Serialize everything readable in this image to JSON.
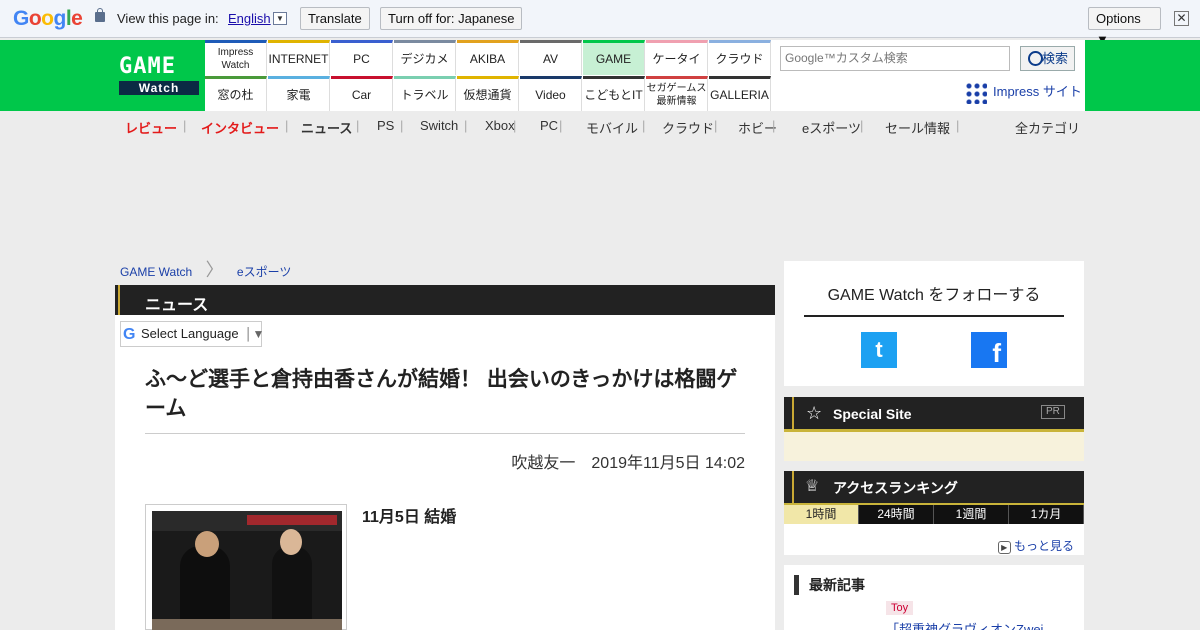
{
  "translate_bar": {
    "logo": "Google",
    "prompt": "View this page in:",
    "language": "English",
    "translate_button": "Translate",
    "turnoff_button": "Turn off for: Japanese",
    "options_button": "Options ▼",
    "close": "✕"
  },
  "header": {
    "logo_top": "GAME",
    "logo_bottom": "Watch",
    "nav_top": [
      "Impress Watch",
      "INTERNET",
      "PC",
      "デジカメ",
      "AKIBA",
      "AV",
      "GAME",
      "ケータイ",
      "クラウド"
    ],
    "nav_bottom": [
      "窓の杜",
      "家電",
      "Car",
      "トラベル",
      "仮想通貨",
      "Video",
      "こどもとIT",
      "セガゲームス 最新情報",
      "GALLERIA"
    ],
    "nav_top_colors": [
      "#1e5bb8",
      "#e0b400",
      "#3a5fd0",
      "#7a8aa0",
      "#e2a21e",
      "#6a6a6a",
      "#00c74a",
      "#f0a0b0",
      "#8ab0e0"
    ],
    "nav_bottom_colors": [
      "#4a9a3a",
      "#5ab0e0",
      "#c8102e",
      "#7acfb0",
      "#e0b400",
      "#1a3a6a",
      "#333333",
      "#d04040",
      "#333333"
    ],
    "search_placeholder": "Google™カスタム検索",
    "search_button": "検索",
    "impress_link": "Impress サイト"
  },
  "categories": {
    "items": [
      "レビュー",
      "インタビュー",
      "ニュース",
      "PS",
      "Switch",
      "Xbox",
      "PC",
      "モバイル",
      "クラウド",
      "ホビー",
      "eスポーツ",
      "セール情報"
    ],
    "all": "全カテゴリ"
  },
  "breadcrumb": [
    "GAME Watch",
    "eスポーツ"
  ],
  "article": {
    "section": "ニュース",
    "select_language": "Select Language",
    "title": "ふ～ど選手と倉持由香さんが結婚！ 出会いのきっかけは格闘ゲーム",
    "author_date": "吹越友一　2019年11月5日 14:02",
    "caption": "11月5日 結婚"
  },
  "sidebar": {
    "follow_title": "GAME Watch をフォローする",
    "special_site": "Special Site",
    "pr": "PR",
    "ranking_title": "アクセスランキング",
    "ranking_tabs": [
      "1時間",
      "24時間",
      "1週間",
      "1カ月"
    ],
    "more": "もっと見る",
    "latest_title": "最新記事",
    "latest_tag": "Toy",
    "latest_item": "「超重神グラヴィオンZwei"
  }
}
